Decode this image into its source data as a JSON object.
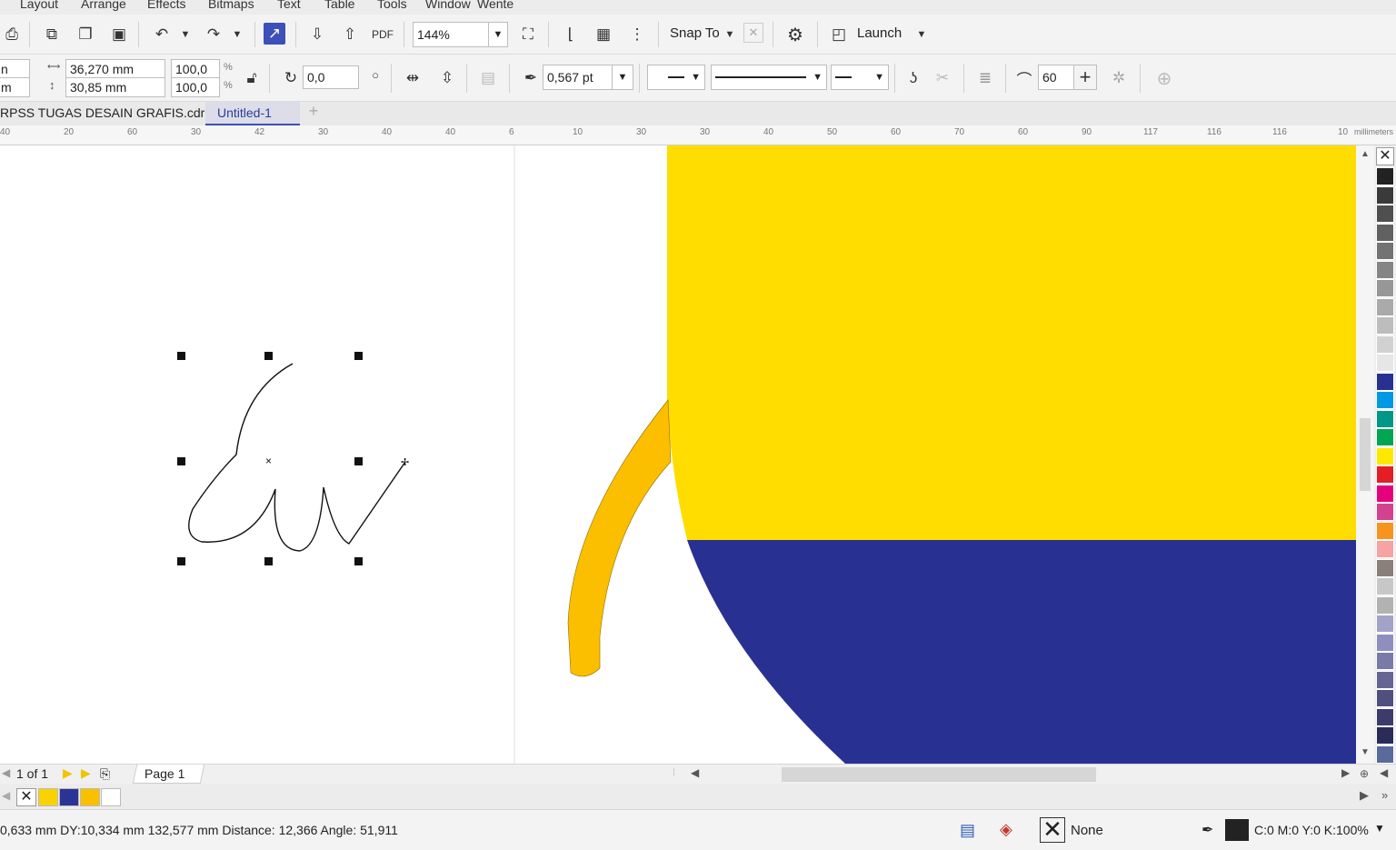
{
  "menu": [
    "Layout",
    "Arrange",
    "Effects",
    "Bitmaps",
    "Text",
    "Table",
    "Tools",
    "Window",
    "Wente"
  ],
  "toolbar1": {
    "zoom_value": "144%",
    "snap_label": "Snap To",
    "launch_label": "Launch"
  },
  "toolbar2": {
    "pos_x_partial": "n",
    "pos_y_partial": "m",
    "width_value": "36,270 mm",
    "height_value": "30,85 mm",
    "scale_w": "100,0",
    "scale_h": "100,0",
    "percent_symbol": "%",
    "rotation_value": "0,0",
    "outline_width": "0,567 pt",
    "smoothing_value": "60"
  },
  "tabs": [
    {
      "label": "RPSS TUGAS DESAIN GRAFIS.cdr"
    },
    {
      "label": "Untitled-1"
    }
  ],
  "ruler": {
    "labels": [
      "40",
      "20",
      "60",
      "30",
      "42",
      "30",
      "40",
      "40",
      "6",
      "10",
      "30",
      "30",
      "40",
      "50",
      "60",
      "70",
      "60",
      "90",
      "117",
      "116",
      "116",
      "10",
      "millimeters"
    ]
  },
  "canvas": {
    "colors": {
      "yellow": "#ffdd00",
      "navy": "#283192",
      "handle_orange": "#fbbf00"
    }
  },
  "pagebar": {
    "page_counter": "1 of 1",
    "page_tab": "Page 1"
  },
  "document_palette": {
    "swatches": [
      "#f9d300",
      "#2b3496",
      "#f9c000",
      "#ffffff"
    ]
  },
  "palette": {
    "swatches": [
      "#222222",
      "#3a3a3a",
      "#4f4f4f",
      "#616161",
      "#737373",
      "#858585",
      "#979797",
      "#aaaaaa",
      "#bdbdbd",
      "#d1d1d1",
      "#e6e6e6",
      "#283192",
      "#0099e6",
      "#009688",
      "#00a651",
      "#ffe800",
      "#e31e24",
      "#e6007e",
      "#d4418e",
      "#f7941d",
      "#f5a3a3",
      "#8a8079",
      "#c7c7c7",
      "#b2b2b2",
      "#a3a3c7",
      "#8f8fbf",
      "#7a7aa8",
      "#656594",
      "#50507f",
      "#3c3c6b",
      "#2b2b59",
      "#5a6a9a",
      "#4a5a8a"
    ]
  },
  "status": {
    "coords_text": "0,633 mm  DY:10,334 mm 132,577 mm Distance: 12,366 Angle: 51,911",
    "fill_label": "None",
    "color_info": "C:0 M:0 Y:0 K:100%"
  }
}
